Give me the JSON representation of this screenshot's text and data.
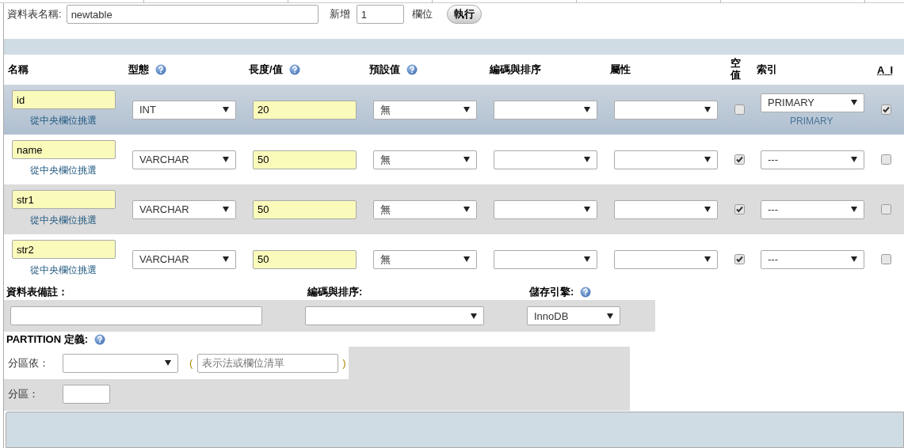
{
  "table_name": {
    "label": "資料表名稱:",
    "value": "newtable"
  },
  "add_fields": {
    "label": "新增",
    "value": "1",
    "unit": "欄位",
    "button": "執行"
  },
  "columns": [
    {
      "label": "名稱",
      "help": false
    },
    {
      "label": "型態",
      "help": true
    },
    {
      "label": "長度/值",
      "help": true
    },
    {
      "label": "預設值",
      "help": true
    },
    {
      "label": "編碼與排序",
      "help": false
    },
    {
      "label": "屬性",
      "help": false
    },
    {
      "label": "空值",
      "help": false
    },
    {
      "label": "索引",
      "help": false
    },
    {
      "label": "A_I",
      "help": false
    }
  ],
  "fields": [
    {
      "name": "id",
      "central": "從中央欄位挑選",
      "type": "INT",
      "length": "20",
      "default": "無",
      "null": false,
      "index": "PRIMARY",
      "index_note": "PRIMARY",
      "auto_increment": true,
      "selected": true
    },
    {
      "name": "name",
      "central": "從中央欄位挑選",
      "type": "VARCHAR",
      "length": "50",
      "default": "無",
      "null": true,
      "index": "---",
      "auto_increment": false,
      "selected": false
    },
    {
      "name": "str1",
      "central": "從中央欄位挑選",
      "type": "VARCHAR",
      "length": "50",
      "default": "無",
      "null": true,
      "index": "---",
      "auto_increment": false,
      "selected": false
    },
    {
      "name": "str2",
      "central": "從中央欄位挑選",
      "type": "VARCHAR",
      "length": "50",
      "default": "無",
      "null": true,
      "index": "---",
      "auto_increment": false,
      "selected": false
    }
  ],
  "table_options": {
    "comment_label": "資料表備註：",
    "collation_label": "編碼與排序:",
    "engine_label": "儲存引擎:",
    "engine_help": true,
    "engine": "InnoDB"
  },
  "partition": {
    "label": "PARTITION 定義:",
    "help": true,
    "by_label": "分區依：",
    "open_paren": "(",
    "expression_placeholder": "表示法或欄位清單",
    "close_paren": ")",
    "count_label": "分區："
  }
}
